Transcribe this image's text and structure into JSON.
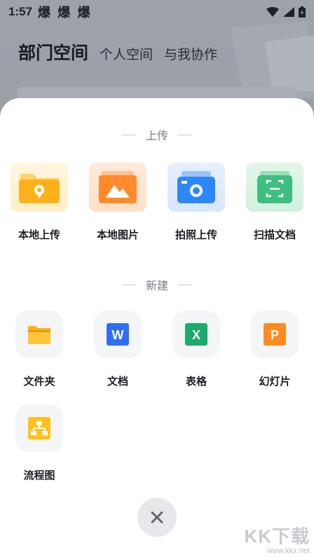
{
  "status_bar": {
    "time": "1:57",
    "notification_icons": "爆 爆 爆",
    "icons": [
      "wifi-icon",
      "signal-icon",
      "battery-icon"
    ]
  },
  "background_app": {
    "tabs": [
      "部门空间",
      "个人空间",
      "与我协作"
    ],
    "active_tab": "部门空间"
  },
  "sheet": {
    "upload_section_title": "上传",
    "upload_items": [
      {
        "label": "本地上传",
        "icon": "folder-location-icon",
        "color": "#FFB11B"
      },
      {
        "label": "本地图片",
        "icon": "image-icon",
        "color": "#FF8A2A"
      },
      {
        "label": "拍照上传",
        "icon": "camera-icon",
        "color": "#2F86F6"
      },
      {
        "label": "扫描文档",
        "icon": "scan-icon",
        "color": "#3FBF7F"
      }
    ],
    "create_section_title": "新建",
    "create_items": [
      {
        "label": "文件夹",
        "icon": "folder-icon",
        "color": "#FFB11B"
      },
      {
        "label": "文档",
        "icon": "word-doc-icon",
        "glyph": "W",
        "color": "#2F6FF0"
      },
      {
        "label": "表格",
        "icon": "spreadsheet-icon",
        "glyph": "X",
        "color": "#1DAA6E"
      },
      {
        "label": "幻灯片",
        "icon": "slides-icon",
        "glyph": "P",
        "color": "#FF8A1F"
      },
      {
        "label": "流程图",
        "icon": "flowchart-icon",
        "color": "#FFC21A"
      }
    ],
    "close_icon": "close-icon"
  },
  "watermark": {
    "main": "KK下载",
    "url": "www.kkx.net"
  }
}
